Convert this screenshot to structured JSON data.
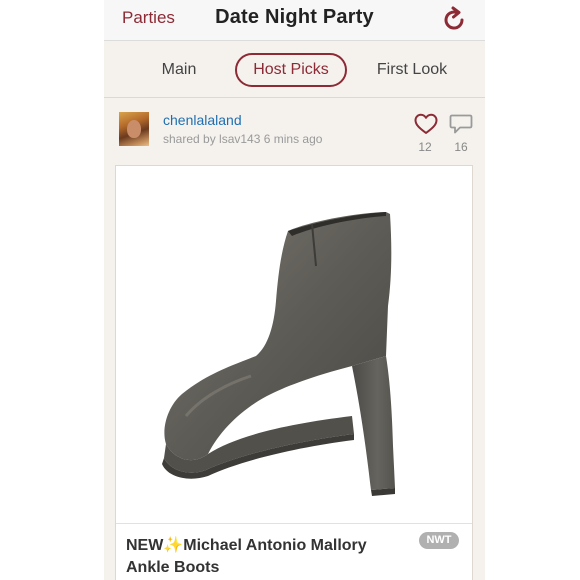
{
  "navbar": {
    "back_label": "Parties",
    "title": "Date Night Party",
    "refresh_icon": "refresh-icon"
  },
  "tabs": [
    {
      "label": "Main",
      "active": false
    },
    {
      "label": "Host Picks",
      "active": true
    },
    {
      "label": "First Look",
      "active": false
    }
  ],
  "listing": {
    "username": "chenlalaland",
    "shared_text": "shared by lsav143 6 mins ago",
    "likes": "12",
    "comments": "16",
    "title_prefix": "NEW",
    "title_sparkle": "✨",
    "title_rest": "Michael Antonio Mallory Ankle Boots",
    "badge": "NWT"
  },
  "colors": {
    "accent": "#8c2a35",
    "link": "#1f6fb0",
    "background": "#f5f2ee"
  }
}
